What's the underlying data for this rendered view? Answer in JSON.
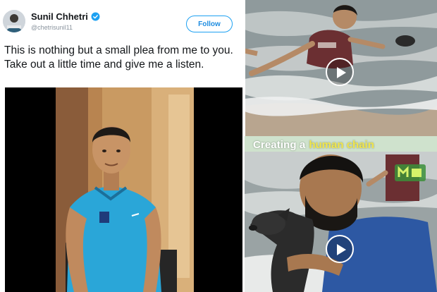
{
  "tweet": {
    "display_name": "Sunil Chhetri",
    "handle": "@chetrisunil11",
    "follow_label": "Follow",
    "text": "This is nothing but a small plea from me to you. Take out a little time and give me a listen."
  },
  "video_caption": {
    "prefix": "Creating a",
    "highlight": "human chain"
  },
  "icons": {
    "verified": "verified-badge-icon",
    "play": "play-icon"
  },
  "colors": {
    "twitter_blue": "#1da1f2",
    "caption_bg": "#cfe2cd",
    "caption_highlight": "#f2e64b"
  }
}
